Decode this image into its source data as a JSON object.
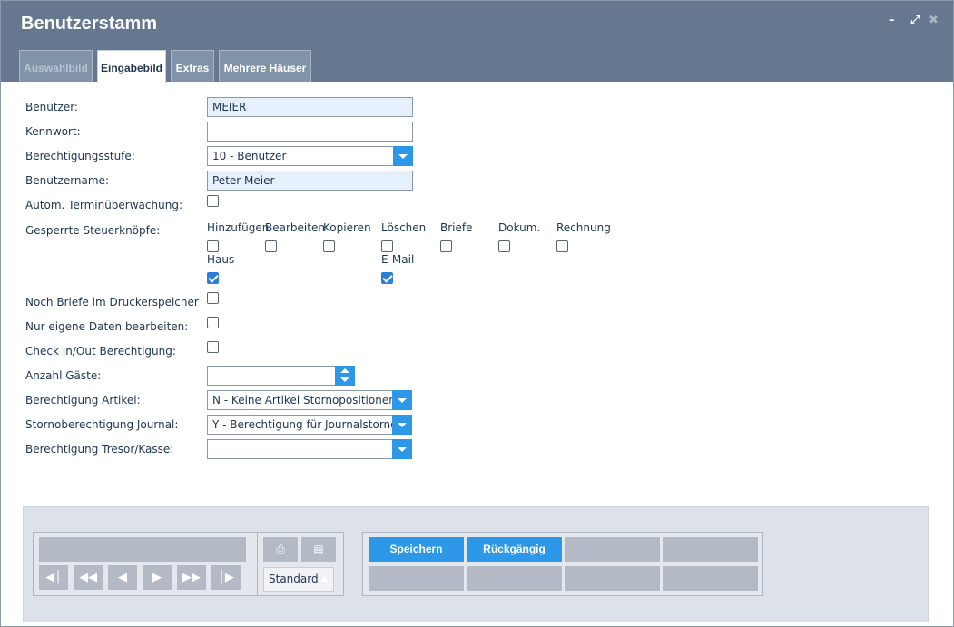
{
  "window": {
    "title": "Benutzerstamm"
  },
  "tabs": [
    {
      "label": "Auswahlbild"
    },
    {
      "label": "Eingabebild"
    },
    {
      "label": "Extras"
    },
    {
      "label": "Mehrere Häuser"
    }
  ],
  "form": {
    "benutzer": {
      "label": "Benutzer:",
      "value": "MEIER"
    },
    "kennwort": {
      "label": "Kennwort:",
      "value": ""
    },
    "berechtigungsstufe": {
      "label": "Berechtigungsstufe:",
      "value": "10 - Benutzer"
    },
    "benutzername": {
      "label": "Benutzername:",
      "value": "Peter Meier"
    },
    "termin": {
      "label": "Autom. Terminüberwachung:",
      "checked": false
    },
    "gesperrt": {
      "label": "Gesperrte Steuerknöpfe:",
      "buttons": [
        {
          "label": "Hinzufügen",
          "checked": false
        },
        {
          "label": "Bearbeiten",
          "checked": false
        },
        {
          "label": "Kopieren",
          "checked": false
        },
        {
          "label": "Löschen",
          "checked": false
        },
        {
          "label": "Briefe",
          "checked": false
        },
        {
          "label": "Dokum.",
          "checked": false
        },
        {
          "label": "Rechnung",
          "checked": false
        },
        {
          "label": "Haus",
          "checked": true
        },
        {
          "label": "E-Mail",
          "checked": true
        }
      ]
    },
    "briefe_drucker": {
      "label": "Noch Briefe im Druckerspeicher",
      "checked": false
    },
    "eigene_daten": {
      "label": "Nur eigene Daten bearbeiten:",
      "checked": false
    },
    "checkinout": {
      "label": "Check In/Out Berechtigung:",
      "checked": false
    },
    "anzahl_gaeste": {
      "label": "Anzahl Gäste:",
      "value": ""
    },
    "berechtigung_artikel": {
      "label": "Berechtigung Artikel:",
      "value": "N - Keine Artikel Stornopositionen"
    },
    "storno_journal": {
      "label": "Stornoberechtigung Journal:",
      "value": "Y - Berechtigung für Journalstorno"
    },
    "tresor_kasse": {
      "label": "Berechtigung Tresor/Kasse:",
      "value": ""
    }
  },
  "footer": {
    "report_select": "Standardli",
    "save_label": "Speichern",
    "undo_label": "Rückgängig"
  },
  "colors": {
    "titlebar": "#65788f",
    "accent": "#2d97e8"
  }
}
